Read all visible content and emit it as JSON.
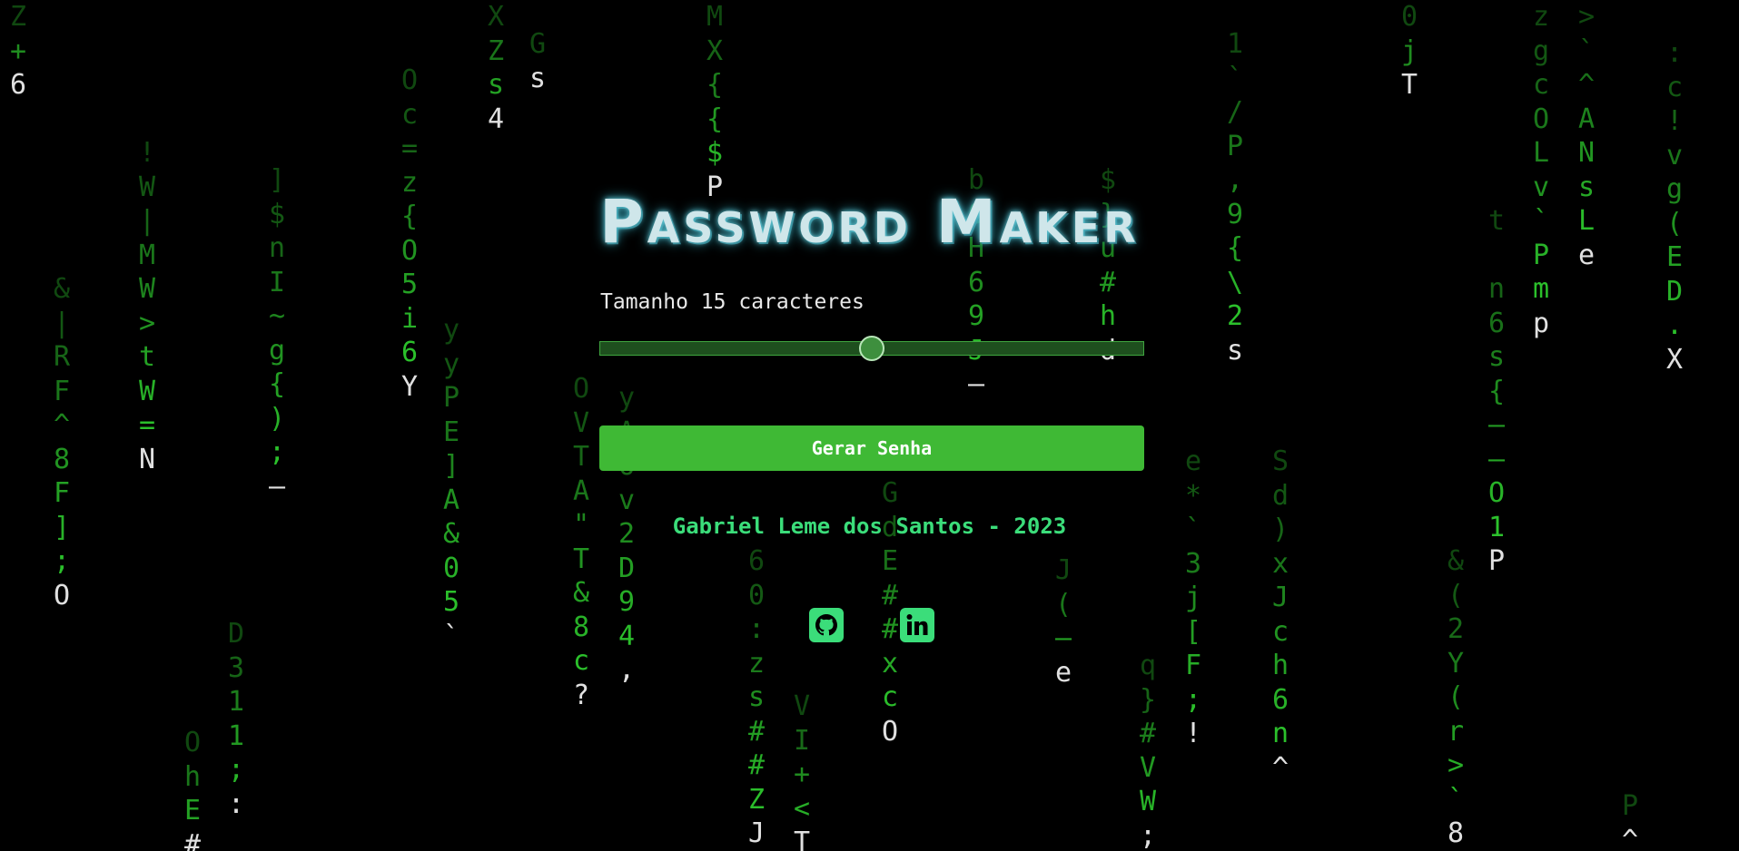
{
  "app": {
    "title": "Password Maker"
  },
  "length_control": {
    "label": "Tamanho",
    "value": "15",
    "unit": "caracteres",
    "min": 1,
    "max": 30,
    "fraction": 0.5
  },
  "generate_button": {
    "label": "Gerar Senha"
  },
  "footer": {
    "credit": "Gabriel Leme dos Santos - 2023",
    "links": [
      {
        "icon": "github-icon",
        "name": "GitHub"
      },
      {
        "icon": "linkedin-icon",
        "name": "LinkedIn"
      }
    ]
  },
  "colors": {
    "background": "#000000",
    "rain_green": "#2fcf2f",
    "rain_head": "#e0e0e0",
    "button": "#3fb935",
    "credit": "#3bdd7a",
    "title_glow": "#66c9d6"
  },
  "matrix_rain": [
    {
      "chars": "Z+6"
    },
    {
      "chars": "&|RF^8F];O"
    },
    {
      "chars": "!W|MW>tW=N"
    },
    {
      "chars": "]$nI~g{);—"
    },
    {
      "chars": "Oc=z{O5i6Y"
    },
    {
      "chars": "yyPE]A&05`"
    },
    {
      "chars": "XZs4"
    },
    {
      "chars": "Gs"
    },
    {
      "chars": "OVTA\"T&8c?"
    },
    {
      "chars": "yA6v2D94,"
    },
    {
      "chars": "MX{{$P"
    },
    {
      "chars": "60:zs##ZJ"
    },
    {
      "chars": "VI+<T"
    },
    {
      "chars": "GdE##xcO"
    },
    {
      "chars": "bOH69J—"
    },
    {
      "chars": "J(—e"
    },
    {
      "chars": "$}u#hd"
    },
    {
      "chars": "e*`3j[F;!"
    },
    {
      "chars": "q}#VW;"
    },
    {
      "chars": "1`/P,9{\\2s"
    },
    {
      "chars": "Sd)xJch6n^"
    },
    {
      "chars": "0jT"
    },
    {
      "chars": "t n6s{——O1P"
    },
    {
      "chars": "zgcOLv`Pmp"
    },
    {
      "chars": ">`^ANsLe"
    },
    {
      "chars": "&(2Y(r>`8"
    },
    {
      "chars": ":c!vg(ED.X"
    },
    {
      "chars": "P^"
    },
    {
      "chars": "D311;:"
    },
    {
      "chars": "OhE#"
    }
  ]
}
